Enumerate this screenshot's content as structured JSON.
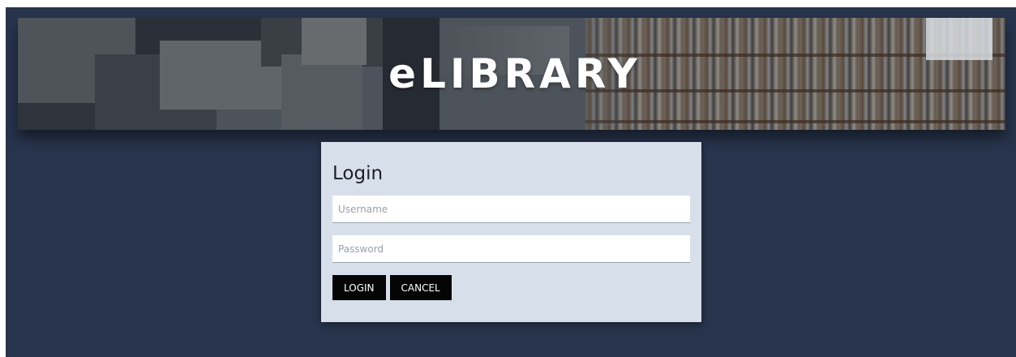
{
  "banner": {
    "title": "eLIBRARY"
  },
  "login": {
    "heading": "Login",
    "username_placeholder": "Username",
    "password_placeholder": "Password",
    "login_label": "LOGIN",
    "cancel_label": "CANCEL"
  },
  "colors": {
    "page_background": "#27344b",
    "card_background": "#d7dfeb",
    "button_background": "#050505"
  }
}
